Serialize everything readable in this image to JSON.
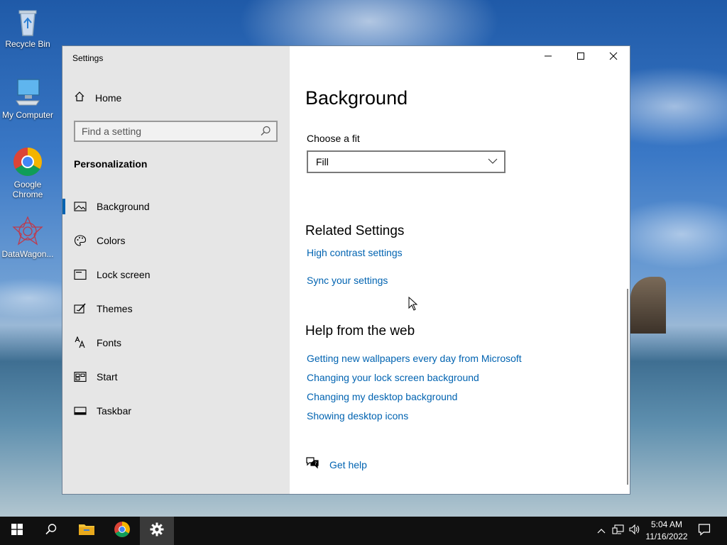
{
  "desktop": {
    "icons": [
      {
        "label": "Recycle Bin",
        "icon": "recycle-bin-icon"
      },
      {
        "label": "My Computer",
        "icon": "computer-icon"
      },
      {
        "label": "Google Chrome",
        "icon": "chrome-icon"
      },
      {
        "label": "DataWagon...",
        "icon": "datawagon-icon"
      }
    ]
  },
  "window": {
    "title": "Settings",
    "controls": {
      "minimize": "minimize-icon",
      "maximize": "maximize-icon",
      "close": "close-icon"
    }
  },
  "sidebar": {
    "home_label": "Home",
    "search_placeholder": "Find a setting",
    "section_title": "Personalization",
    "items": [
      {
        "label": "Background",
        "icon": "picture-icon",
        "selected": true
      },
      {
        "label": "Colors",
        "icon": "palette-icon",
        "selected": false
      },
      {
        "label": "Lock screen",
        "icon": "lock-screen-icon",
        "selected": false
      },
      {
        "label": "Themes",
        "icon": "themes-icon",
        "selected": false
      },
      {
        "label": "Fonts",
        "icon": "fonts-icon",
        "selected": false
      },
      {
        "label": "Start",
        "icon": "start-icon",
        "selected": false
      },
      {
        "label": "Taskbar",
        "icon": "taskbar-icon",
        "selected": false
      }
    ]
  },
  "main": {
    "title": "Background",
    "fit_label": "Choose a fit",
    "fit_value": "Fill",
    "related_title": "Related Settings",
    "related_links": [
      "High contrast settings",
      "Sync your settings"
    ],
    "help_title": "Help from the web",
    "help_links": [
      "Getting new wallpapers every day from Microsoft",
      "Changing your lock screen background",
      "Changing my desktop background",
      "Showing desktop icons"
    ],
    "get_help": "Get help"
  },
  "taskbar": {
    "time": "5:04 AM",
    "date": "11/16/2022",
    "colors": {
      "accent": "#0063b1",
      "taskbar": "#101010"
    }
  }
}
